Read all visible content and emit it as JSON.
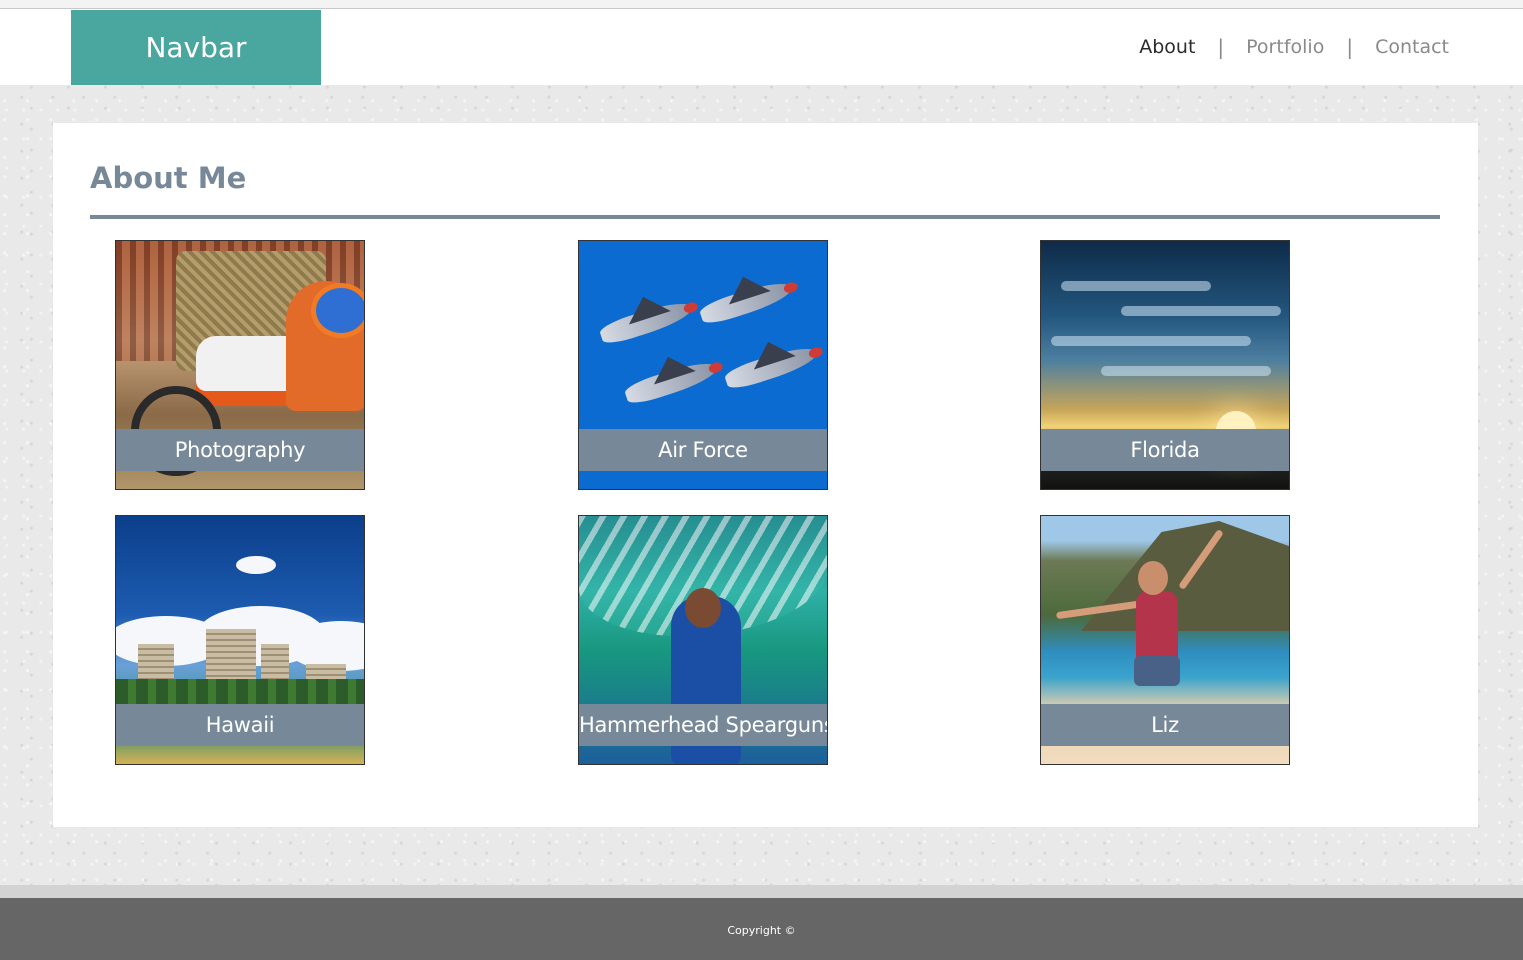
{
  "navbar": {
    "brand": "Navbar",
    "links": [
      {
        "label": "About",
        "active": true
      },
      {
        "label": "Portfolio",
        "active": false
      },
      {
        "label": "Contact",
        "active": false
      }
    ],
    "separator": "|",
    "brand_color": "#4aa79f"
  },
  "main": {
    "title": "About Me",
    "accent_color": "#778899",
    "tiles": [
      {
        "caption": "Photography",
        "image": "motocross-rider"
      },
      {
        "caption": "Air Force",
        "image": "jet-formation"
      },
      {
        "caption": "Florida",
        "image": "sunset-sky"
      },
      {
        "caption": "Hawaii",
        "image": "hotel-skyline"
      },
      {
        "caption": "Hammerhead Spearguns",
        "image": "diver-in-waves"
      },
      {
        "caption": "Liz",
        "image": "woman-jumping-on-beach"
      }
    ]
  },
  "footer": {
    "copyright": "Copyright ©"
  }
}
